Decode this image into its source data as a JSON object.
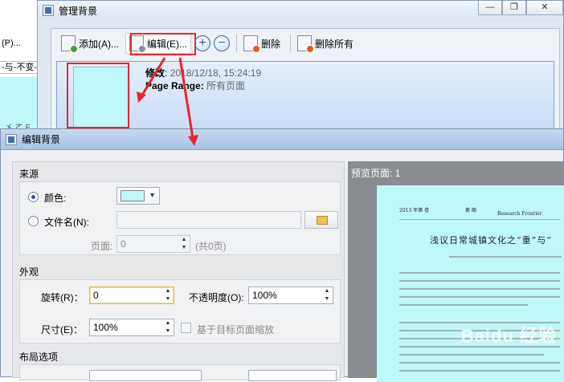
{
  "background_app": {
    "menu_fragment": "(P)...",
    "toolbar_fragment": "-与-不变-",
    "page_text": "㐅 ㄜ E"
  },
  "manager_window": {
    "title": "管理背景",
    "window_controls": [
      "—",
      "❐",
      "✕"
    ],
    "toolbar": {
      "add_label": "添加(A)...",
      "edit_label": "编辑(E)...",
      "zoom_in_symbol": "+",
      "zoom_out_symbol": "−",
      "delete_label": "删除",
      "delete_all_label": "删除所有"
    },
    "item": {
      "modified_label": "修改",
      "modified_value": "2018/12/18, 15:24:19",
      "page_range_label": "Page Range:",
      "page_range_value": "所有页面"
    }
  },
  "edit_dialog": {
    "title": "编辑背景",
    "source": {
      "header": "来源",
      "color_label": "颜色:",
      "file_label": "文件名(N):",
      "page_label": "页面:",
      "page_value": "0",
      "page_total": "(共0页)",
      "file_value": ""
    },
    "appearance": {
      "header": "外观",
      "rotation_label": "旋转(R)：",
      "rotation_value": "0",
      "opacity_label": "不透明度(O):",
      "opacity_value": "100%",
      "size_label": "尺寸(E)：",
      "size_value": "100%",
      "scale_relative_label": "基于目标页面缩放"
    },
    "layout": {
      "header": "布局选项"
    },
    "preview": {
      "header": "预览页面: 1",
      "doc_header_left": "2013 年第 卷",
      "doc_header_mid": "第 期",
      "doc_header_right": "Research Frontier",
      "doc_title": "浅议日常城镇文化之“重”与“",
      "watermark": "Baidu 经验"
    },
    "colors": {
      "background_color": "#bff8f8"
    }
  }
}
